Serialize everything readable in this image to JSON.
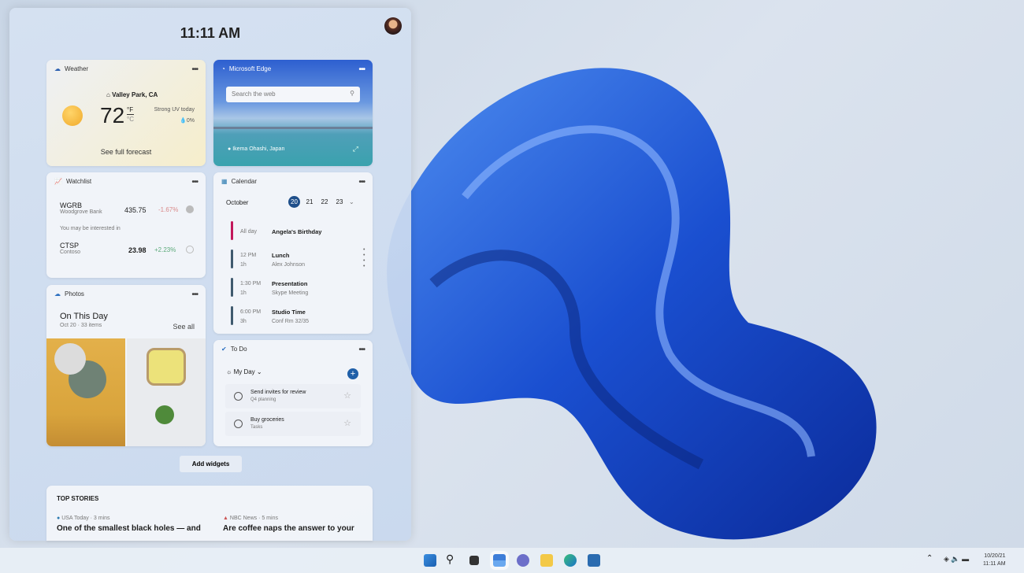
{
  "clock": "11:11 AM",
  "weather": {
    "title": "Weather",
    "location": "Valley Park, CA",
    "temp": "72",
    "unit_f": "°F",
    "unit_c": "°C",
    "uv": "Strong UV today",
    "precip": "0%",
    "link": "See full forecast"
  },
  "edge": {
    "title": "Microsoft Edge",
    "search_placeholder": "Search the web",
    "location": "Ikema Ohashi, Japan"
  },
  "watchlist": {
    "title": "Watchlist",
    "stocks": [
      {
        "symbol": "WGRB",
        "name": "Woodgrove Bank",
        "price": "435.75",
        "change": "-1.67%"
      },
      {
        "symbol": "CTSP",
        "name": "Contoso",
        "price": "23.98",
        "change": "+2.23%"
      }
    ],
    "interest_label": "You may be interested in"
  },
  "calendar": {
    "title": "Calendar",
    "month": "October",
    "days": [
      "20",
      "21",
      "22",
      "23"
    ],
    "events": [
      {
        "time": "All day",
        "dur": "",
        "title": "Angela's Birthday",
        "sub": "",
        "color": "#c2185b"
      },
      {
        "time": "12 PM",
        "dur": "1h",
        "title": "Lunch",
        "sub": "Alex Johnson",
        "color": "#3f5a6e"
      },
      {
        "time": "1:30 PM",
        "dur": "1h",
        "title": "Presentation",
        "sub": "Skype Meeting",
        "color": "#3f5a6e"
      },
      {
        "time": "6:00 PM",
        "dur": "3h",
        "title": "Studio Time",
        "sub": "Conf Rm 32/35",
        "color": "#3f5a6e"
      }
    ]
  },
  "photos": {
    "title": "Photos",
    "heading": "On This Day",
    "sub": "Oct 20 · 33 items",
    "see_all": "See all"
  },
  "todo": {
    "title": "To Do",
    "list": "My Day",
    "tasks": [
      {
        "title": "Send invites for review",
        "sub": "Q4 planning"
      },
      {
        "title": "Buy groceries",
        "sub": "Tasks"
      }
    ]
  },
  "add_widgets": "Add widgets",
  "stories": {
    "title": "TOP STORIES",
    "items": [
      {
        "source": "USA Today · 3 mins",
        "headline": "One of the smallest black holes — and"
      },
      {
        "source": "NBC News · 5 mins",
        "headline": "Are coffee naps the answer to your"
      }
    ]
  },
  "taskbar": {
    "date": "10/20/21",
    "time": "11:11 AM",
    "icons": [
      "start-icon",
      "search-icon",
      "task-view-icon",
      "widgets-icon",
      "chat-icon",
      "file-explorer-icon",
      "edge-icon",
      "store-icon"
    ]
  },
  "colors": {
    "accent": "#1f5fa8",
    "negative": "#d9534f",
    "positive": "#2e9d5b"
  }
}
